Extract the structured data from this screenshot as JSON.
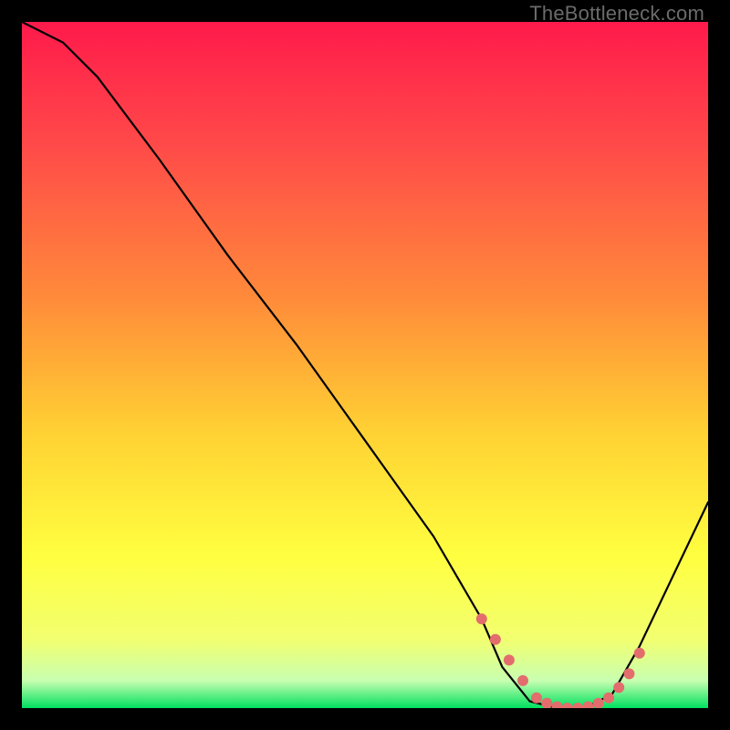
{
  "watermark": "TheBottleneck.com",
  "chart_data": {
    "type": "line",
    "title": "",
    "xlabel": "",
    "ylabel": "",
    "xlim": [
      0,
      100
    ],
    "ylim": [
      0,
      100
    ],
    "grid": false,
    "legend": false,
    "gradient_stops": [
      {
        "pct": 0,
        "color": "#ff1a4b"
      },
      {
        "pct": 18,
        "color": "#ff4a49"
      },
      {
        "pct": 40,
        "color": "#ff8a3a"
      },
      {
        "pct": 60,
        "color": "#ffd233"
      },
      {
        "pct": 78,
        "color": "#ffff40"
      },
      {
        "pct": 90,
        "color": "#f2ff70"
      },
      {
        "pct": 96,
        "color": "#c8ffb0"
      },
      {
        "pct": 100,
        "color": "#00e060"
      }
    ],
    "series": [
      {
        "name": "bottleneck-curve",
        "color": "#000000",
        "x": [
          0,
          6,
          11,
          20,
          30,
          40,
          50,
          60,
          67,
          70,
          74,
          78,
          82,
          86,
          90,
          100
        ],
        "y": [
          100,
          97,
          92,
          80,
          66,
          53,
          39,
          25,
          13,
          6,
          1,
          0,
          0,
          2,
          9,
          30
        ]
      },
      {
        "name": "optimal-range-markers",
        "color": "#e36d6d",
        "type": "scatter",
        "x": [
          67,
          69,
          71,
          73,
          75,
          76.5,
          78,
          79.5,
          81,
          82.5,
          84,
          85.5,
          87,
          88.5,
          90
        ],
        "y": [
          13,
          10,
          7,
          4,
          1.5,
          0.7,
          0.2,
          0,
          0,
          0.2,
          0.7,
          1.5,
          3,
          5,
          8
        ]
      }
    ]
  }
}
